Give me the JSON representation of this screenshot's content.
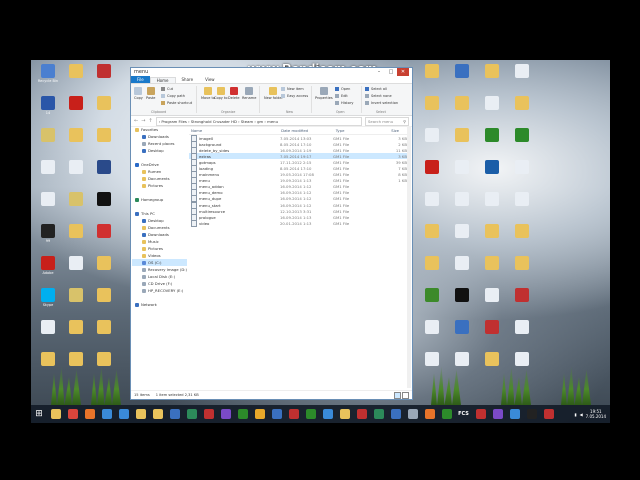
{
  "watermark": "www.Bandicam.com",
  "desktop": {
    "icons": [
      {
        "label": "Recycle Bin",
        "color": "#4a7fd0"
      },
      {
        "label": "14",
        "color": "#2a56a8"
      },
      {
        "label": "",
        "color": "#d8c26a"
      },
      {
        "label": "",
        "color": "#e9eef4"
      },
      {
        "label": "",
        "color": "#e9eef4"
      },
      {
        "label": "99",
        "color": "#222"
      },
      {
        "label": "Adobe",
        "color": "#c8201a"
      },
      {
        "label": "Skype",
        "color": "#00aff0"
      },
      {
        "label": "",
        "color": "#e9eef4"
      },
      {
        "label": "",
        "color": "#e9c25c"
      },
      {
        "label": "",
        "color": "#e9c25c"
      },
      {
        "label": "",
        "color": "#c8201a"
      },
      {
        "label": "",
        "color": "#e9c25c"
      },
      {
        "label": "",
        "color": "#e9eef4"
      },
      {
        "label": "",
        "color": "#d8c26a"
      },
      {
        "label": "",
        "color": "#e9c25c"
      },
      {
        "label": "",
        "color": "#e9eef4"
      },
      {
        "label": "",
        "color": "#d8c26a"
      },
      {
        "label": "",
        "color": "#e9c25c"
      },
      {
        "label": "",
        "color": "#e9c25c"
      },
      {
        "label": "",
        "color": "#c03030"
      },
      {
        "label": "",
        "color": "#e9c25c"
      },
      {
        "label": "",
        "color": "#e9c25c"
      },
      {
        "label": "",
        "color": "#2a4a8a"
      },
      {
        "label": "",
        "color": "#111"
      },
      {
        "label": "",
        "color": "#d03030"
      },
      {
        "label": "",
        "color": "#e9c25c"
      },
      {
        "label": "",
        "color": "#e9c25c"
      },
      {
        "label": "",
        "color": "#e9c25c"
      },
      {
        "label": "",
        "color": "#e9c25c"
      }
    ],
    "right_icons": [
      {
        "label": "",
        "color": "#e9c25c"
      },
      {
        "label": "",
        "color": "#e9c25c"
      },
      {
        "label": "",
        "color": "#e9eef4"
      },
      {
        "label": "",
        "color": "#c8201a"
      },
      {
        "label": "",
        "color": "#e9eef4"
      },
      {
        "label": "",
        "color": "#e9c25c"
      },
      {
        "label": "",
        "color": "#e9c25c"
      },
      {
        "label": "",
        "color": "#3c8a2a"
      },
      {
        "label": "",
        "color": "#e9eef4"
      },
      {
        "label": "",
        "color": "#e9eef4"
      },
      {
        "label": "",
        "color": "#3a70c0"
      },
      {
        "label": "",
        "color": "#e9c25c"
      },
      {
        "label": "",
        "color": "#e9c25c"
      },
      {
        "label": "",
        "color": "#e9eef4"
      },
      {
        "label": "",
        "color": "#e9eef4"
      },
      {
        "label": "",
        "color": "#e9eef4"
      },
      {
        "label": "",
        "color": "#e9eef4"
      },
      {
        "label": "",
        "color": "#111"
      },
      {
        "label": "",
        "color": "#3a70c0"
      },
      {
        "label": "",
        "color": "#e9eef4"
      },
      {
        "label": "",
        "color": "#e9c25c"
      },
      {
        "label": "",
        "color": "#e9eef4"
      },
      {
        "label": "",
        "color": "#2c8a2a"
      },
      {
        "label": "",
        "color": "#1b5ea8"
      },
      {
        "label": "",
        "color": "#e9eef4"
      },
      {
        "label": "",
        "color": "#e9c25c"
      },
      {
        "label": "",
        "color": "#e9c25c"
      },
      {
        "label": "",
        "color": "#e9eef4"
      },
      {
        "label": "",
        "color": "#c03030"
      },
      {
        "label": "",
        "color": "#e9c25c"
      },
      {
        "label": "",
        "color": "#e9eef4"
      },
      {
        "label": "",
        "color": "#e9c25c"
      },
      {
        "label": "",
        "color": "#2c8a2a"
      },
      {
        "label": "",
        "color": "#e9eef4"
      },
      {
        "label": "",
        "color": "#e9eef4"
      },
      {
        "label": "",
        "color": "#e9c25c"
      },
      {
        "label": "",
        "color": "#e9c25c"
      },
      {
        "label": "",
        "color": "#c03030"
      },
      {
        "label": "",
        "color": "#e9eef4"
      },
      {
        "label": "",
        "color": "#e9eef4"
      }
    ]
  },
  "explorer": {
    "title": "menu",
    "controls": {
      "minimize": "–",
      "maximize": "□",
      "close": "✕"
    },
    "ribbon_tabs": {
      "file": "File",
      "home": "Home",
      "share": "Share",
      "view": "View"
    },
    "ribbon": {
      "copy": "Copy",
      "paste": "Paste",
      "cut": "Cut",
      "copy_path": "Copy path",
      "paste_shortcut": "Paste shortcut",
      "move_to": "Move to",
      "copy_to": "Copy to",
      "delete": "Delete",
      "rename": "Rename",
      "new_folder": "New folder",
      "new_item": "New item",
      "easy_access": "Easy access",
      "properties": "Properties",
      "open": "Open",
      "edit": "Edit",
      "history": "History",
      "select_all": "Select all",
      "select_none": "Select none",
      "invert_selection": "Invert selection",
      "group_clipboard": "Clipboard",
      "group_organize": "Organize",
      "group_new": "New",
      "group_open": "Open",
      "group_select": "Select"
    },
    "nav": {
      "back": "←",
      "forward": "→",
      "up": "↑"
    },
    "address": "›  Program Files  ›  Stronghold Crusader HD  ›  Steam  ›  gm  ›  menu",
    "search_placeholder": "Search menu",
    "navpane": [
      {
        "label": "Favorites",
        "level": 1,
        "color": "#e8c25c"
      },
      {
        "label": "Downloads",
        "level": 2,
        "color": "#3a70c0"
      },
      {
        "label": "Recent places",
        "level": 2,
        "color": "#9aa8b8"
      },
      {
        "label": "Desktop",
        "level": 2,
        "color": "#3a70c0"
      },
      {
        "label": "",
        "level": 1,
        "color": "transparent"
      },
      {
        "label": "OneDrive",
        "level": 1,
        "color": "#2a6ac8"
      },
      {
        "label": "Rumen",
        "level": 2,
        "color": "#e8c25c"
      },
      {
        "label": "Documents",
        "level": 2,
        "color": "#e8c25c"
      },
      {
        "label": "Pictures",
        "level": 2,
        "color": "#e8c25c"
      },
      {
        "label": "",
        "level": 1,
        "color": "transparent"
      },
      {
        "label": "Homegroup",
        "level": 1,
        "color": "#2c8a5a"
      },
      {
        "label": "",
        "level": 1,
        "color": "transparent"
      },
      {
        "label": "This PC",
        "level": 1,
        "color": "#3a70c0"
      },
      {
        "label": "Desktop",
        "level": 2,
        "color": "#3a70c0"
      },
      {
        "label": "Documents",
        "level": 2,
        "color": "#e8c25c"
      },
      {
        "label": "Downloads",
        "level": 2,
        "color": "#3a70c0"
      },
      {
        "label": "Music",
        "level": 2,
        "color": "#e8c25c"
      },
      {
        "label": "Pictures",
        "level": 2,
        "color": "#e8c25c"
      },
      {
        "label": "Videos",
        "level": 2,
        "color": "#e8c25c"
      },
      {
        "label": "OS (C:)",
        "level": 2,
        "color": "#5a8ad8",
        "selected": true
      },
      {
        "label": "Recovery Image (D:)",
        "level": 2,
        "color": "#9aa8b8"
      },
      {
        "label": "Local Disk (E:)",
        "level": 2,
        "color": "#9aa8b8"
      },
      {
        "label": "CD Drive (F:)",
        "level": 2,
        "color": "#9aa8b8"
      },
      {
        "label": "HP_RECOVERY (E:)",
        "level": 2,
        "color": "#9aa8b8"
      },
      {
        "label": "",
        "level": 1,
        "color": "transparent"
      },
      {
        "label": "Network",
        "level": 1,
        "color": "#3a70c0"
      }
    ],
    "columns": {
      "name": "Name",
      "date": "Date modified",
      "type": "Type",
      "size": "Size"
    },
    "files": [
      {
        "name": "image0",
        "date": "7.05.2014 13:03",
        "type": "GM1 File",
        "size": "3 KB",
        "kind": "file"
      },
      {
        "name": "background",
        "date": "8.05.2014 17:10",
        "type": "GM1 File",
        "size": "2 KB",
        "kind": "file"
      },
      {
        "name": "delete_by_sides",
        "date": "16.09.2014 1:19",
        "type": "GM1 File",
        "size": "11 KB",
        "kind": "file"
      },
      {
        "name": "extras",
        "date": "7.05.2014 19:17",
        "type": "GM1 File",
        "size": "3 KB",
        "kind": "file",
        "selected": true
      },
      {
        "name": "gotmaps",
        "date": "17.11.2012 2:15",
        "type": "GM1 File",
        "size": "39 KB",
        "kind": "file"
      },
      {
        "name": "loading",
        "date": "8.05.2014 17:10",
        "type": "GM1 File",
        "size": "7 KB",
        "kind": "file"
      },
      {
        "name": "mainmenu",
        "date": "19.05.2014 17:08",
        "type": "GM1 File",
        "size": "8 KB",
        "kind": "file"
      },
      {
        "name": "menu",
        "date": "19.09.2014 1:13",
        "type": "GM1 File",
        "size": "1 KB",
        "kind": "file"
      },
      {
        "name": "menu_addon",
        "date": "16.09.2014 1:12",
        "type": "GM1 File",
        "size": "",
        "kind": "file"
      },
      {
        "name": "menu_demo",
        "date": "16.09.2014 1:12",
        "type": "GM1 File",
        "size": "",
        "kind": "file"
      },
      {
        "name": "menu_dupe",
        "date": "16.09.2014 1:12",
        "type": "GM1 File",
        "size": "",
        "kind": "file"
      },
      {
        "name": "menu_start",
        "date": "16.09.2014 1:12",
        "type": "GM1 File",
        "size": "",
        "kind": "file"
      },
      {
        "name": "multiresource",
        "date": "12.10.2013 3:31",
        "type": "GM1 File",
        "size": "",
        "kind": "file"
      },
      {
        "name": "prologue",
        "date": "16.09.2014 1:13",
        "type": "GM1 File",
        "size": "",
        "kind": "file"
      },
      {
        "name": "video",
        "date": "20.01.2014 1:13",
        "type": "GM1 File",
        "size": "",
        "kind": "file"
      }
    ],
    "status": {
      "count": "15 items",
      "selected": "1 item selected  2,31 KB"
    }
  },
  "taskbar": {
    "start_icon": "⊞",
    "items": [
      {
        "name": "file-explorer",
        "color": "#e8c25c"
      },
      {
        "name": "chrome",
        "color": "#d9453c"
      },
      {
        "name": "firefox",
        "color": "#e8742a"
      },
      {
        "name": "ie",
        "color": "#3a8ad8"
      },
      {
        "name": "store",
        "color": "#3a8ad8"
      },
      {
        "name": "folder",
        "color": "#e8c25c"
      },
      {
        "name": "folder2",
        "color": "#e8c25c"
      },
      {
        "name": "media",
        "color": "#3a70c0"
      },
      {
        "name": "app1",
        "color": "#2c8a5a"
      },
      {
        "name": "app2",
        "color": "#c03030"
      },
      {
        "name": "app3",
        "color": "#7a4ac8"
      },
      {
        "name": "app4",
        "color": "#2c8a2a"
      },
      {
        "name": "app5",
        "color": "#e8a82a"
      },
      {
        "name": "app6",
        "color": "#3a70c0"
      },
      {
        "name": "app7",
        "color": "#c03030"
      },
      {
        "name": "app8",
        "color": "#2c8a2a"
      },
      {
        "name": "app9",
        "color": "#3a8ad8"
      },
      {
        "name": "app10",
        "color": "#e8c25c"
      },
      {
        "name": "app11",
        "color": "#c03030"
      },
      {
        "name": "app12",
        "color": "#2c8a5a"
      },
      {
        "name": "app13",
        "color": "#3a70c0"
      },
      {
        "name": "app14",
        "color": "#9aa8b8"
      },
      {
        "name": "app15",
        "color": "#e8742a"
      },
      {
        "name": "app16",
        "color": "#2c8a2a"
      }
    ],
    "fcs_label": "FCS",
    "tray_items": [
      {
        "name": "app17",
        "color": "#c03030"
      },
      {
        "name": "app18",
        "color": "#7a4ac8"
      },
      {
        "name": "app19",
        "color": "#3a8ad8"
      },
      {
        "name": "app20",
        "color": "#222"
      },
      {
        "name": "app21",
        "color": "#c03030"
      }
    ],
    "time": "19:51",
    "date": "7.05.2014"
  }
}
